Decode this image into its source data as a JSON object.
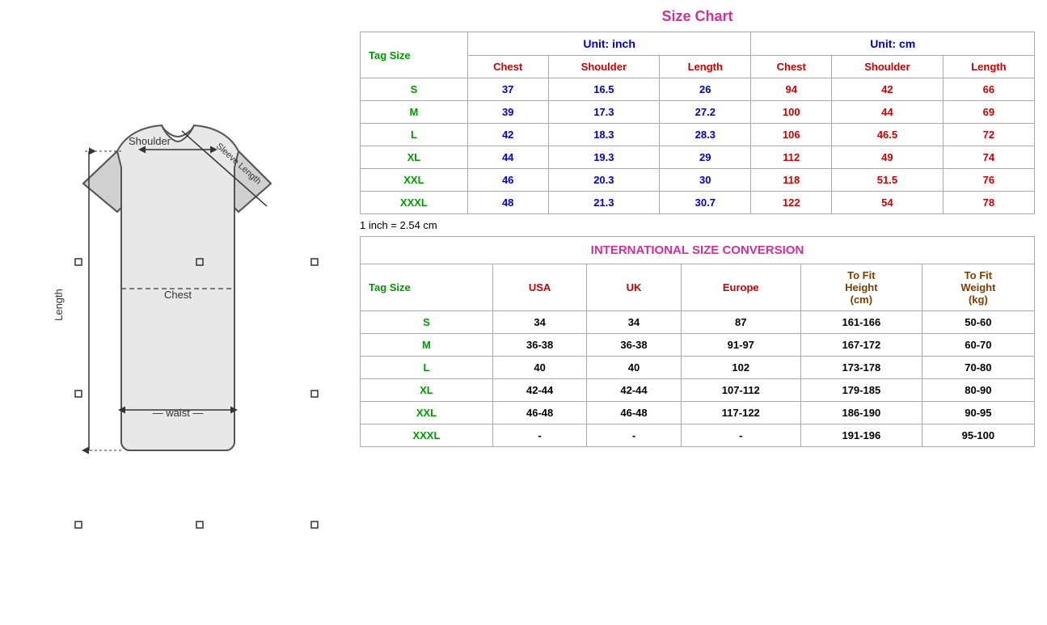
{
  "left": {
    "alt": "T-shirt measurement diagram"
  },
  "right": {
    "size_chart_title": "Size Chart",
    "inch_note": "1 inch = 2.54 cm",
    "unit_inch": "Unit: inch",
    "unit_cm": "Unit: cm",
    "tag_size_label": "Tag Size",
    "columns_inch": [
      "Chest",
      "Shoulder",
      "Length"
    ],
    "columns_cm": [
      "Chest",
      "Shoulder",
      "Length"
    ],
    "rows": [
      {
        "tag": "S",
        "chest_in": "37",
        "shoulder_in": "16.5",
        "length_in": "26",
        "chest_cm": "94",
        "shoulder_cm": "42",
        "length_cm": "66"
      },
      {
        "tag": "M",
        "chest_in": "39",
        "shoulder_in": "17.3",
        "length_in": "27.2",
        "chest_cm": "100",
        "shoulder_cm": "44",
        "length_cm": "69"
      },
      {
        "tag": "L",
        "chest_in": "42",
        "shoulder_in": "18.3",
        "length_in": "28.3",
        "chest_cm": "106",
        "shoulder_cm": "46.5",
        "length_cm": "72"
      },
      {
        "tag": "XL",
        "chest_in": "44",
        "shoulder_in": "19.3",
        "length_in": "29",
        "chest_cm": "112",
        "shoulder_cm": "49",
        "length_cm": "74"
      },
      {
        "tag": "XXL",
        "chest_in": "46",
        "shoulder_in": "20.3",
        "length_in": "30",
        "chest_cm": "118",
        "shoulder_cm": "51.5",
        "length_cm": "76"
      },
      {
        "tag": "XXXL",
        "chest_in": "48",
        "shoulder_in": "21.3",
        "length_in": "30.7",
        "chest_cm": "122",
        "shoulder_cm": "54",
        "length_cm": "78"
      }
    ],
    "intl_title": "INTERNATIONAL SIZE CONVERSION",
    "intl_tag_label": "Tag Size",
    "intl_columns": [
      "USA",
      "UK",
      "Europe",
      "To Fit Height (cm)",
      "To Fit Weight (kg)"
    ],
    "intl_rows": [
      {
        "tag": "S",
        "usa": "34",
        "uk": "34",
        "europe": "87",
        "height": "161-166",
        "weight": "50-60"
      },
      {
        "tag": "M",
        "usa": "36-38",
        "uk": "36-38",
        "europe": "91-97",
        "height": "167-172",
        "weight": "60-70"
      },
      {
        "tag": "L",
        "usa": "40",
        "uk": "40",
        "europe": "102",
        "height": "173-178",
        "weight": "70-80"
      },
      {
        "tag": "XL",
        "usa": "42-44",
        "uk": "42-44",
        "europe": "107-112",
        "height": "179-185",
        "weight": "80-90"
      },
      {
        "tag": "XXL",
        "usa": "46-48",
        "uk": "46-48",
        "europe": "117-122",
        "height": "186-190",
        "weight": "90-95"
      },
      {
        "tag": "XXXL",
        "usa": "-",
        "uk": "-",
        "europe": "-",
        "height": "191-196",
        "weight": "95-100"
      }
    ]
  }
}
